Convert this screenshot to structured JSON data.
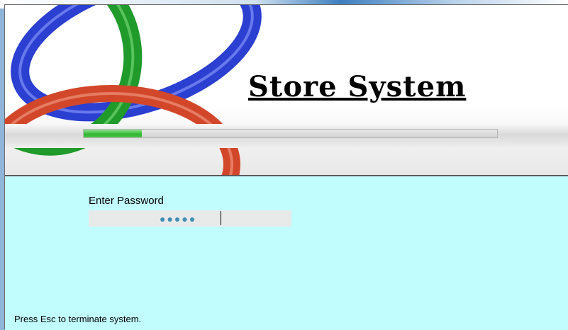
{
  "banner": {
    "title": "Store System"
  },
  "progress": {
    "value_percent": 14
  },
  "login": {
    "label": "Enter Password",
    "masked_value": "●●●●●"
  },
  "footer": {
    "status_text": "Press Esc to terminate system."
  },
  "colors": {
    "panel_background": "#c2fdfe",
    "progress_fill": "#2fb52f",
    "ring_green": "#1f9a2b",
    "ring_blue": "#2b3fd0",
    "ring_red": "#d2472a",
    "password_dots": "#3d8db4"
  }
}
